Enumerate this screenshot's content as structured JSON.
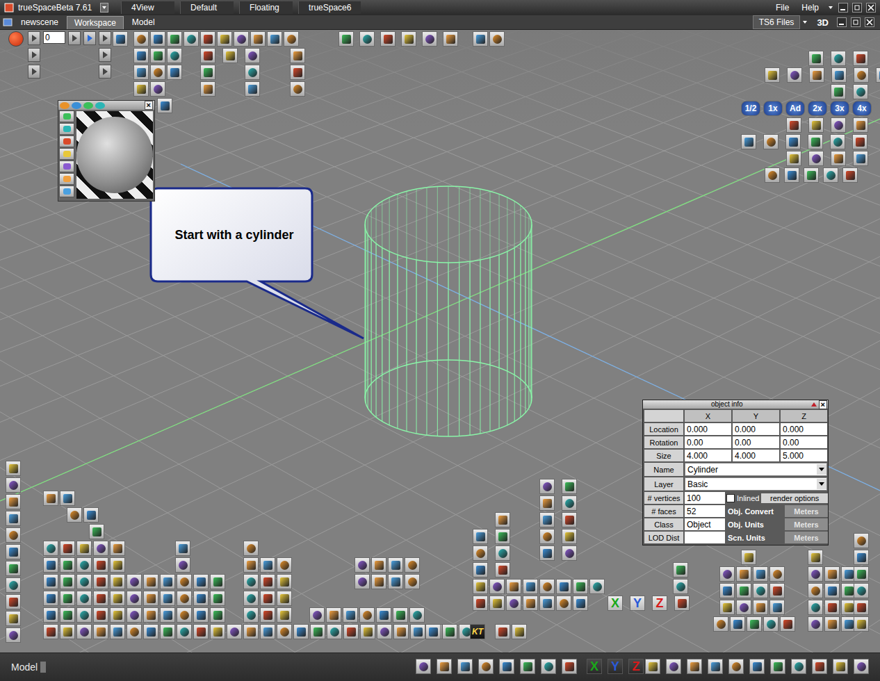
{
  "window": {
    "title": "trueSpaceBeta 7.61",
    "menu": [
      "4View",
      "Default",
      "Floating",
      "trueSpace6"
    ],
    "menu_right": [
      "File",
      "Help"
    ]
  },
  "tabs": [
    {
      "label": "newscene",
      "selected": false
    },
    {
      "label": "Workspace",
      "selected": true
    },
    {
      "label": "Model",
      "selected": false
    }
  ],
  "view_controls": {
    "files": "TS6 Files",
    "mode": "3D"
  },
  "frame": "0",
  "material_close": "×",
  "callout": "Start with a cylinder",
  "object_info": {
    "title": "object info",
    "close": "×",
    "columns": [
      "X",
      "Y",
      "Z"
    ],
    "rows": [
      {
        "label": "Location",
        "values": [
          "0.000",
          "0.000",
          "0.000"
        ]
      },
      {
        "label": "Rotation",
        "values": [
          "0.00",
          "0.00",
          "0.00"
        ]
      },
      {
        "label": "Size",
        "values": [
          "4.000",
          "4.000",
          "5.000"
        ]
      }
    ],
    "name": {
      "label": "Name",
      "value": "Cylinder"
    },
    "layer": {
      "label": "Layer",
      "value": "Basic"
    },
    "vertices": {
      "label": "# vertices",
      "value": "100"
    },
    "faces": {
      "label": "# faces",
      "value": "52"
    },
    "class": {
      "label": "Class",
      "value": "Object"
    },
    "lod": {
      "label": "LOD Dist",
      "value": ""
    },
    "inlined": {
      "label": "Inlined",
      "checked": false
    },
    "render_options": "render options",
    "units": [
      {
        "label": "Obj. Convert",
        "value": "Meters"
      },
      {
        "label": "Obj. Units",
        "value": "Meters"
      },
      {
        "label": "Scn. Units",
        "value": "Meters"
      }
    ]
  },
  "zoom_buttons": [
    "1/2",
    "1x",
    "Ad",
    "2x",
    "3x",
    "4x"
  ],
  "axis_buttons": [
    {
      "label": "X",
      "color": "#1aa81a"
    },
    {
      "label": "Y",
      "color": "#2a5ad8"
    },
    {
      "label": "Z",
      "color": "#d81a1a"
    }
  ],
  "status_axis_buttons": [
    {
      "label": "X",
      "color": "#1aa81a"
    },
    {
      "label": "Y",
      "color": "#2a5ad8"
    },
    {
      "label": "Z",
      "color": "#d81a1a"
    }
  ],
  "kt_label": "KT",
  "status_bar": {
    "mode": "Model"
  }
}
